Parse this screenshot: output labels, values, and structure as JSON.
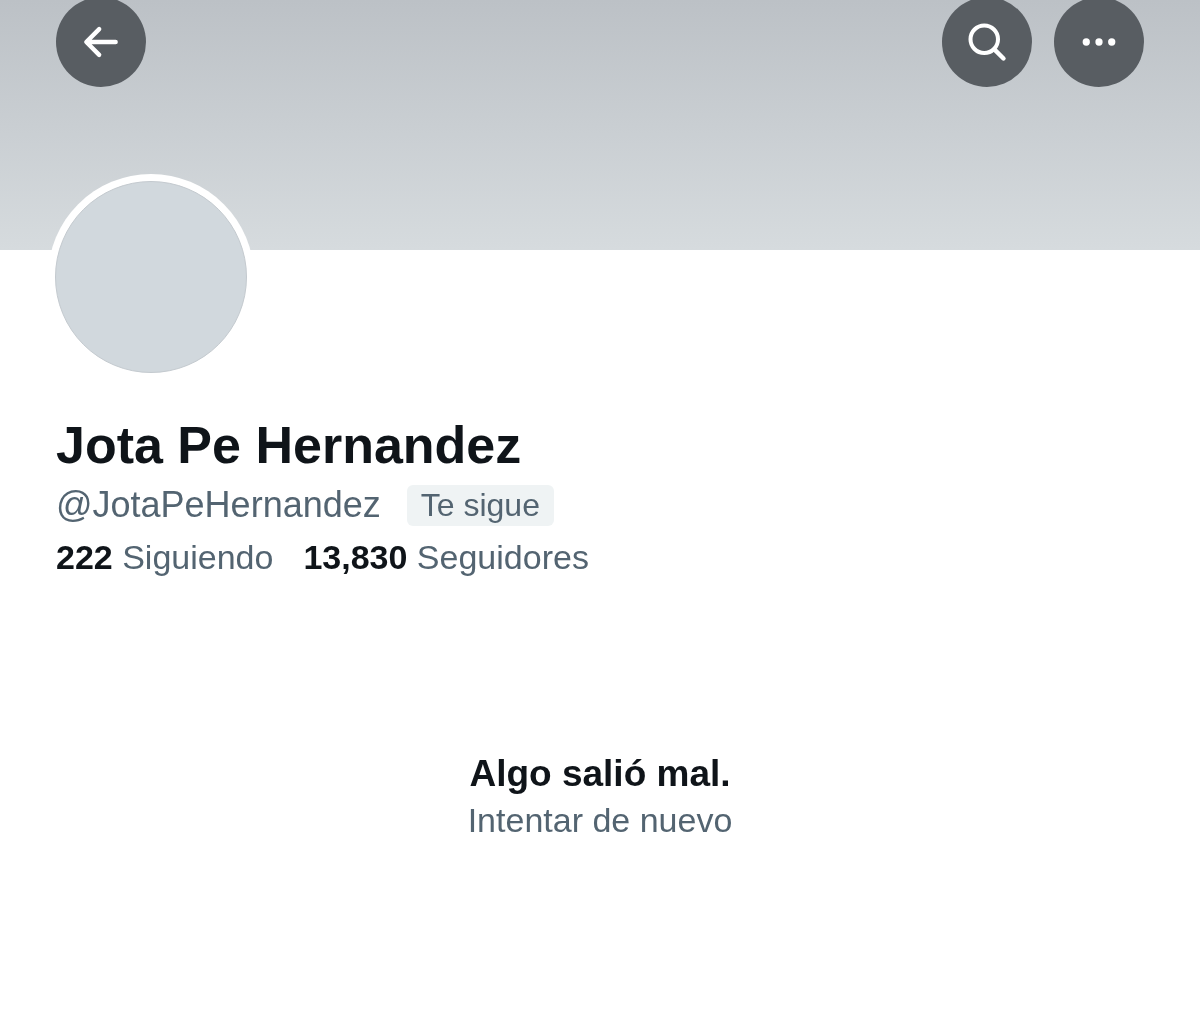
{
  "header": {
    "buttons": [
      {
        "kind": "back"
      },
      {
        "kind": "search"
      },
      {
        "kind": "more"
      }
    ]
  },
  "profile": {
    "name": "Jota Pe Hernandez",
    "handle": "@JotaPeHernandez",
    "follows_you_badge": "Te sigue",
    "stats": [
      {
        "count": "222",
        "label": "Siguiendo"
      },
      {
        "count": "13,830",
        "label": "Seguidores"
      }
    ]
  },
  "error": {
    "title": "Algo salió mal.",
    "retry": "Intentar de nuevo"
  }
}
